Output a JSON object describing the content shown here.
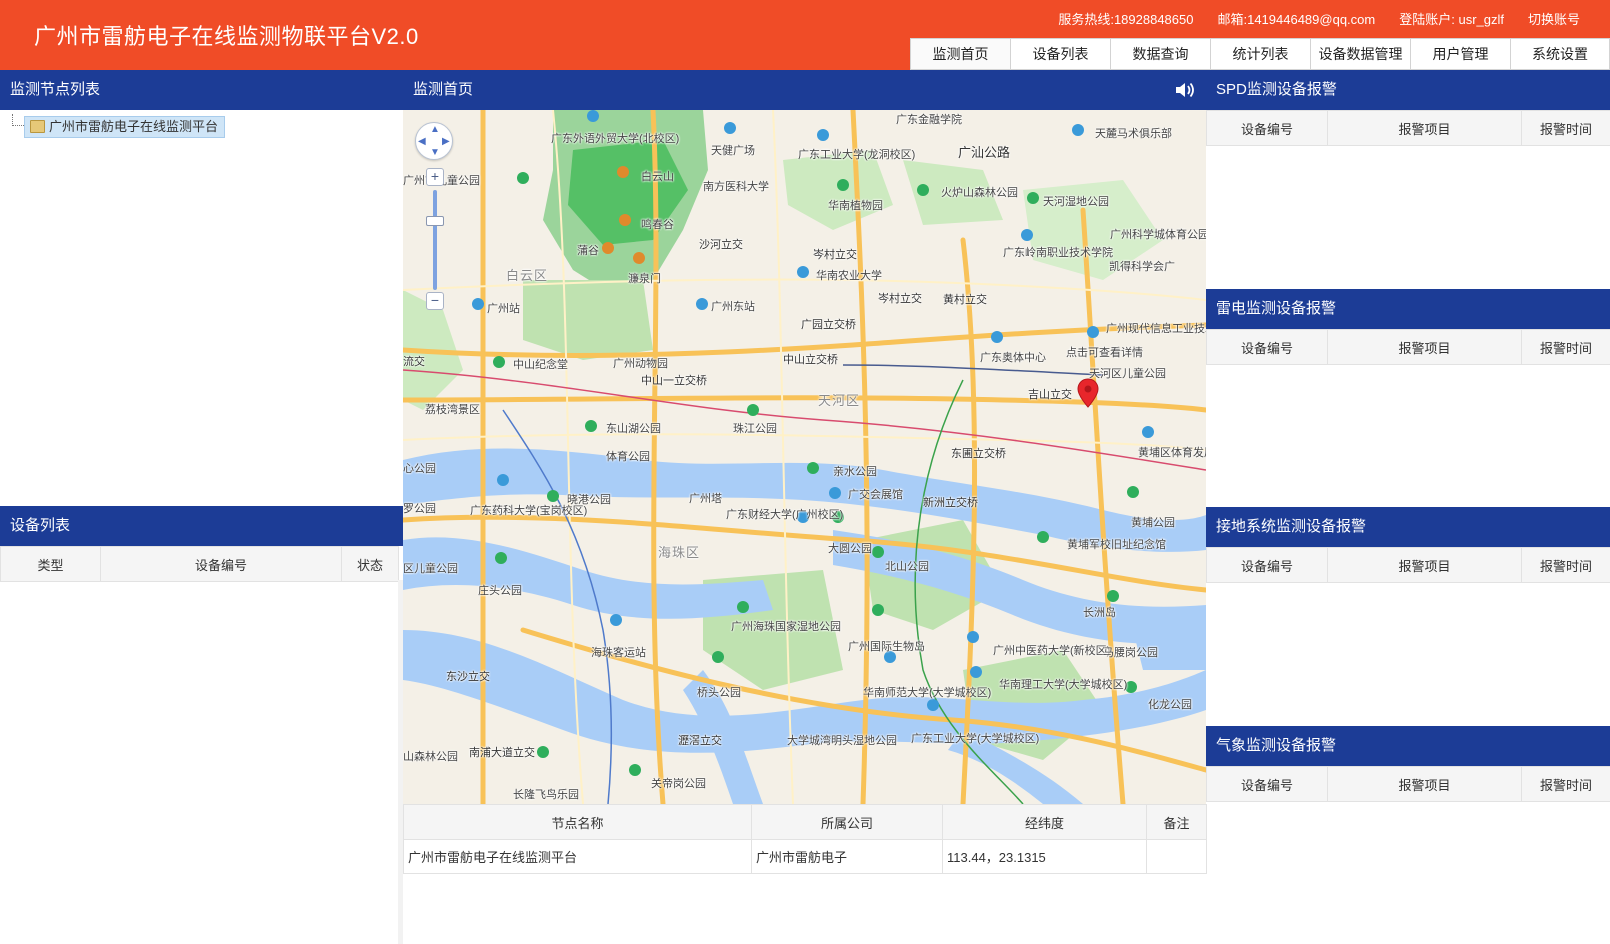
{
  "header": {
    "title": "广州市雷舫电子在线监测物联平台V2.0",
    "hotline": "服务热线:18928848650",
    "email": "邮箱:1419446489@qq.com",
    "account": "登陆账户: usr_gzlf",
    "switch_account": "切换账号"
  },
  "nav": {
    "tabs": [
      "监测首页",
      "设备列表",
      "数据查询",
      "统计列表",
      "设备数据管理",
      "用户管理",
      "系统设置"
    ],
    "active": "监测首页"
  },
  "left": {
    "node_list_title": "监测节点列表",
    "tree_root": "广州市雷舫电子在线监测平台",
    "device_list_title": "设备列表",
    "device_columns": [
      "类型",
      "设备编号",
      "状态"
    ]
  },
  "center": {
    "title": "监测首页",
    "node_table": {
      "columns": [
        "节点名称",
        "所属公司",
        "经纬度",
        "备注"
      ],
      "rows": [
        [
          "广州市雷舫电子在线监测平台",
          "广州市雷舫电子",
          "113.44，23.1315",
          ""
        ]
      ]
    },
    "map_labels": {
      "districts": [
        "白云区",
        "天河区",
        "海珠区"
      ],
      "places": [
        "广东外语外贸大学(北校区)",
        "天健广场",
        "南方医科大学",
        "广东工业大学(龙洞校区)",
        "广东金融学院",
        "天麓马术俱乐部",
        "广汕公路",
        "广州市儿童公园",
        "白云山",
        "鸣春谷",
        "华南植物园",
        "火炉山森林公园",
        "天河湿地公园",
        "蒲谷",
        "濂泉门",
        "沙河立交",
        "岑村立交",
        "华南农业大学",
        "广东岭南职业技术学院",
        "广州科学城体育公园",
        "凯得科学会广",
        "广州站",
        "广州东站",
        "岑村立交",
        "黄村立交",
        "广园立交桥",
        "广州现代信息工业技术学院(北校",
        "点击可查看详情",
        "广东奥体中心",
        "天河区儿童公园",
        "吉山立交",
        "中山纪念堂",
        "广州动物园",
        "中山一立交桥",
        "中山立交桥",
        "荔枝湾景区",
        "东山湖公园",
        "珠江公园",
        "黄埔区体育发展中心",
        "体育公园",
        "广州塔",
        "亲水公园",
        "东圃立交桥",
        "广东药科大学(宝岗校区)",
        "晓港公园",
        "广东财经大学(广州校区)",
        "广交会展馆",
        "新洲立交桥",
        "黄埔公园",
        "大圆公园",
        "北山公园",
        "黄埔军校旧址纪念馆",
        "区儿童公园",
        "庄头公园",
        "长洲岛",
        "广州海珠国家湿地公园",
        "广州国际生物岛",
        "广州中医药大学(新校区)",
        "马腰岗公园",
        "海珠客运站",
        "华南师范大学(大学城校区)",
        "华南理工大学(大学城校区)",
        "东沙立交",
        "桥头公园",
        "化龙公园",
        "大学城湾明头湿地公园",
        "广东工业大学(大学城校区)",
        "南浦大道立交",
        "瀝滘立交",
        "长隆飞鸟乐园",
        "关帝岗公园",
        "山森林公园",
        "流交",
        "心公园",
        "罗公园"
      ]
    }
  },
  "right": {
    "panels": [
      {
        "title": "SPD监测设备报警",
        "columns": [
          "设备编号",
          "报警项目",
          "报警时间"
        ]
      },
      {
        "title": "雷电监测设备报警",
        "columns": [
          "设备编号",
          "报警项目",
          "报警时间"
        ]
      },
      {
        "title": "接地系统监测设备报警",
        "columns": [
          "设备编号",
          "报警项目",
          "报警时间"
        ]
      },
      {
        "title": "气象监测设备报警",
        "columns": [
          "设备编号",
          "报警项目",
          "报警时间"
        ]
      }
    ]
  },
  "colors": {
    "header_bg": "#f04c27",
    "panel_header_bg": "#1c3c96",
    "marker": "#e8262b"
  },
  "icons": [
    "volume-icon",
    "folder-icon",
    "map-pan-icon",
    "zoom-in-icon",
    "zoom-out-icon",
    "map-marker-icon"
  ]
}
